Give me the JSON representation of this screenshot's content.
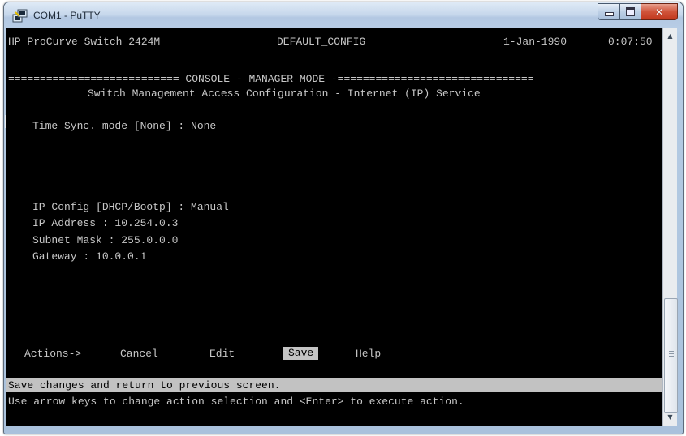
{
  "window": {
    "title": "COM1 - PuTTY",
    "icon": "putty-icon"
  },
  "terminal": {
    "header_device": "HP ProCurve Switch 2424M",
    "header_config": "DEFAULT_CONFIG",
    "header_date": "1-Jan-1990",
    "header_time": "0:07:50",
    "mode_banner": "=========================== CONSOLE - MANAGER MODE -===============================",
    "screen_title": "Switch Management Access Configuration - Internet (IP) Service",
    "time_sync": "Time Sync. mode [None] : None",
    "ip_config": "IP Config [DHCP/Bootp] : Manual",
    "ip_address": "IP Address : 10.254.0.3",
    "subnet_mask": "Subnet Mask : 255.0.0.0",
    "gateway": "Gateway : 10.0.0.1",
    "actions_label": "Actions->",
    "actions": [
      {
        "label": "Cancel"
      },
      {
        "label": "Edit"
      },
      {
        "label": "Save"
      },
      {
        "label": "Help"
      }
    ],
    "selected_action": "Save",
    "status_line": "Save changes and return to previous screen.",
    "help_line": "Use arrow keys to change action selection and <Enter> to execute action."
  },
  "colors": {
    "terminal_bg": "#000000",
    "terminal_fg": "#c7c7c7",
    "highlight_bg": "#c4c4c4",
    "close_button": "#c2381d"
  }
}
